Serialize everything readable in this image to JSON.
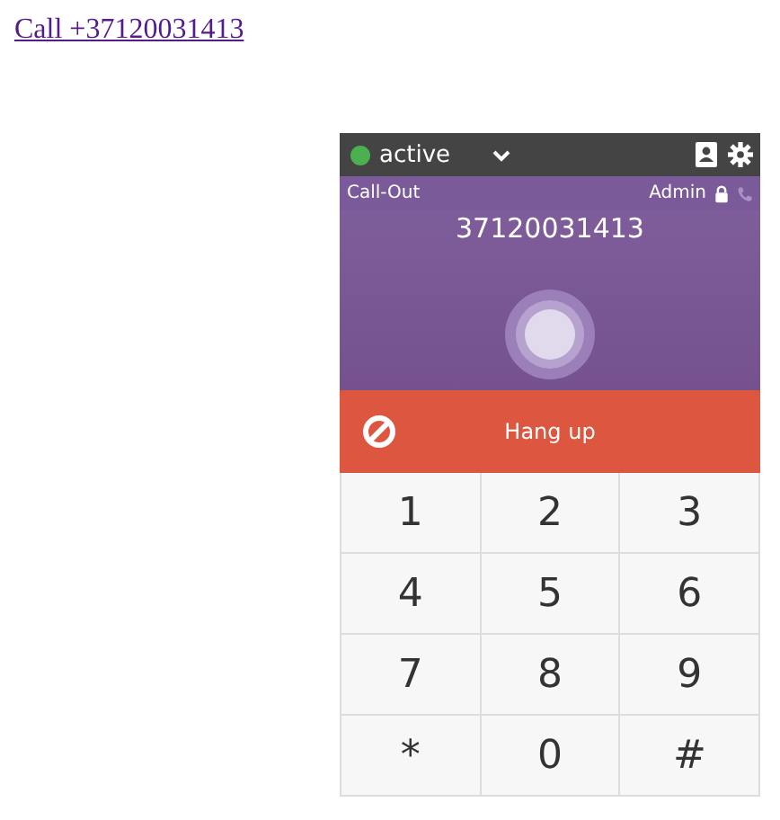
{
  "link": {
    "text": "Call +37120031413"
  },
  "widget": {
    "status": {
      "label": "active",
      "color": "#4caf50"
    },
    "call_type": "Call-Out",
    "user": "Admin",
    "number": "37120031413",
    "hangup": {
      "label": "Hang up"
    },
    "keys": [
      "1",
      "2",
      "3",
      "4",
      "5",
      "6",
      "7",
      "8",
      "9",
      "*",
      "0",
      "#"
    ]
  }
}
